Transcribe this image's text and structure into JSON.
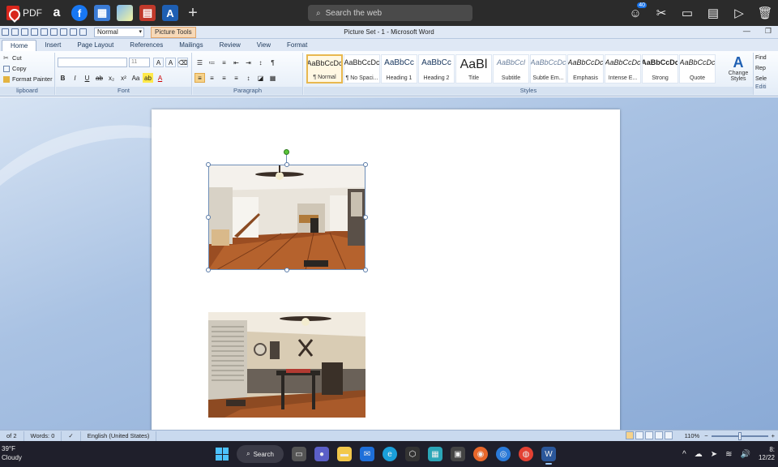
{
  "browser_bar": {
    "pdf_label": "PDF",
    "search_placeholder": "Search the web",
    "notification_count": "40"
  },
  "word": {
    "quick_style": "Normal",
    "contextual_tab": "Picture Tools",
    "window_title": "Picture Set - 1 - Microsoft Word"
  },
  "tabs": [
    "Home",
    "Insert",
    "Page Layout",
    "References",
    "Mailings",
    "Review",
    "View",
    "Format"
  ],
  "ribbon": {
    "clipboard": {
      "items": [
        "Cut",
        "Copy",
        "Format Painter"
      ],
      "label": "lipboard"
    },
    "font": {
      "size": "11",
      "label": "Font"
    },
    "paragraph": {
      "label": "Paragraph"
    },
    "styles": {
      "label": "Styles",
      "gallery": [
        {
          "sample": "AaBbCcDc",
          "name": "¶ Normal"
        },
        {
          "sample": "AaBbCcDc",
          "name": "¶ No Spaci..."
        },
        {
          "sample": "AaBbCc",
          "name": "Heading 1"
        },
        {
          "sample": "AaBbCc",
          "name": "Heading 2"
        },
        {
          "sample": "AaBl",
          "name": "Title"
        },
        {
          "sample": "AaBbCcl",
          "name": "Subtitle"
        },
        {
          "sample": "AaBbCcDc",
          "name": "Subtle Em..."
        },
        {
          "sample": "AaBbCcDc",
          "name": "Emphasis"
        },
        {
          "sample": "AaBbCcDc",
          "name": "Intense E..."
        },
        {
          "sample": "AaBbCcDc",
          "name": "Strong"
        },
        {
          "sample": "AaBbCcDc",
          "name": "Quote"
        }
      ],
      "change_styles": "Change Styles"
    },
    "editing": {
      "items": [
        "Find",
        "Rep",
        "Sele"
      ],
      "label": "Editi"
    }
  },
  "statusbar": {
    "page": "of 2",
    "words": "Words: 0",
    "language": "English (United States)",
    "zoom": "110%"
  },
  "taskbar": {
    "temperature": "39°F",
    "condition": "Cloudy",
    "search_label": "Search",
    "time": "8:",
    "date": "12/22"
  },
  "colors": {
    "ribbon_blue": "#dfe8f5",
    "doc_background": "#a9c2e3",
    "taskbar": "#1f1f2b",
    "selection_handle": "#5a7ba8",
    "rotate_handle": "#5ac53a"
  }
}
